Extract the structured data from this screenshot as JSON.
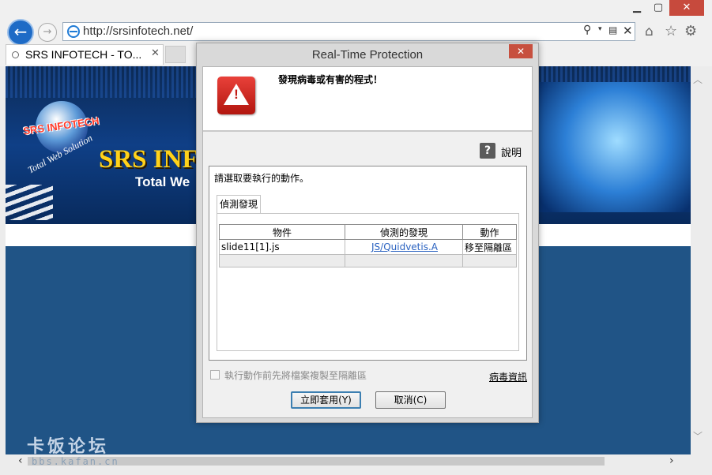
{
  "browser": {
    "window_controls": {
      "minimize": "▁",
      "maximize": "▢",
      "close": "✕"
    },
    "back_icon": "arrow-left-icon",
    "forward_icon": "arrow-right-icon",
    "address_url": "http://srsinfotech.net/",
    "address_icons": {
      "search": "⚲",
      "dropdown": "▾",
      "compat": "▤",
      "stop": "✕"
    },
    "tab_title": "SRS INFOTECH - TO...",
    "tab_close": "✕",
    "toolbar_icons": {
      "home": "⌂",
      "favorites": "☆",
      "settings": "⚙"
    },
    "scroll_glyphs": {
      "up": "︿",
      "down": "﹀",
      "left": "‹",
      "right": "›"
    }
  },
  "page": {
    "logo_tag": "SRS INFOTECH",
    "logo_sub": "Total Web Solution",
    "brand": "SRS INF",
    "brand_tagline": "Total We",
    "header_color": "#0f3f86",
    "body_color": "#205486"
  },
  "watermark": {
    "text": "卡饭论坛",
    "url": "bbs.kafan.cn"
  },
  "dialog": {
    "title": "Real-Time Protection",
    "close": "✕",
    "alert_message": "發現病毒或有害的程式！",
    "warning_glyph": "!",
    "help_glyph": "?",
    "help_label": "說明",
    "action_prompt": "請選取要執行的動作。",
    "tab_label": "偵測發現",
    "table": {
      "headers": [
        "物件",
        "偵測的發現",
        "動作"
      ],
      "rows": [
        {
          "object": "slide11[1].js",
          "detection": "JS/Quidvetis.A",
          "action": "移至隔離區"
        }
      ]
    },
    "copy_checkbox_label": "執行動作前先將檔案複製至隔離區",
    "copy_checkbox_checked": false,
    "virus_info_link": "病毒資訊",
    "apply_button": "立即套用(Y)",
    "cancel_button": "取消(C)",
    "accent_color": "#c7503f"
  }
}
